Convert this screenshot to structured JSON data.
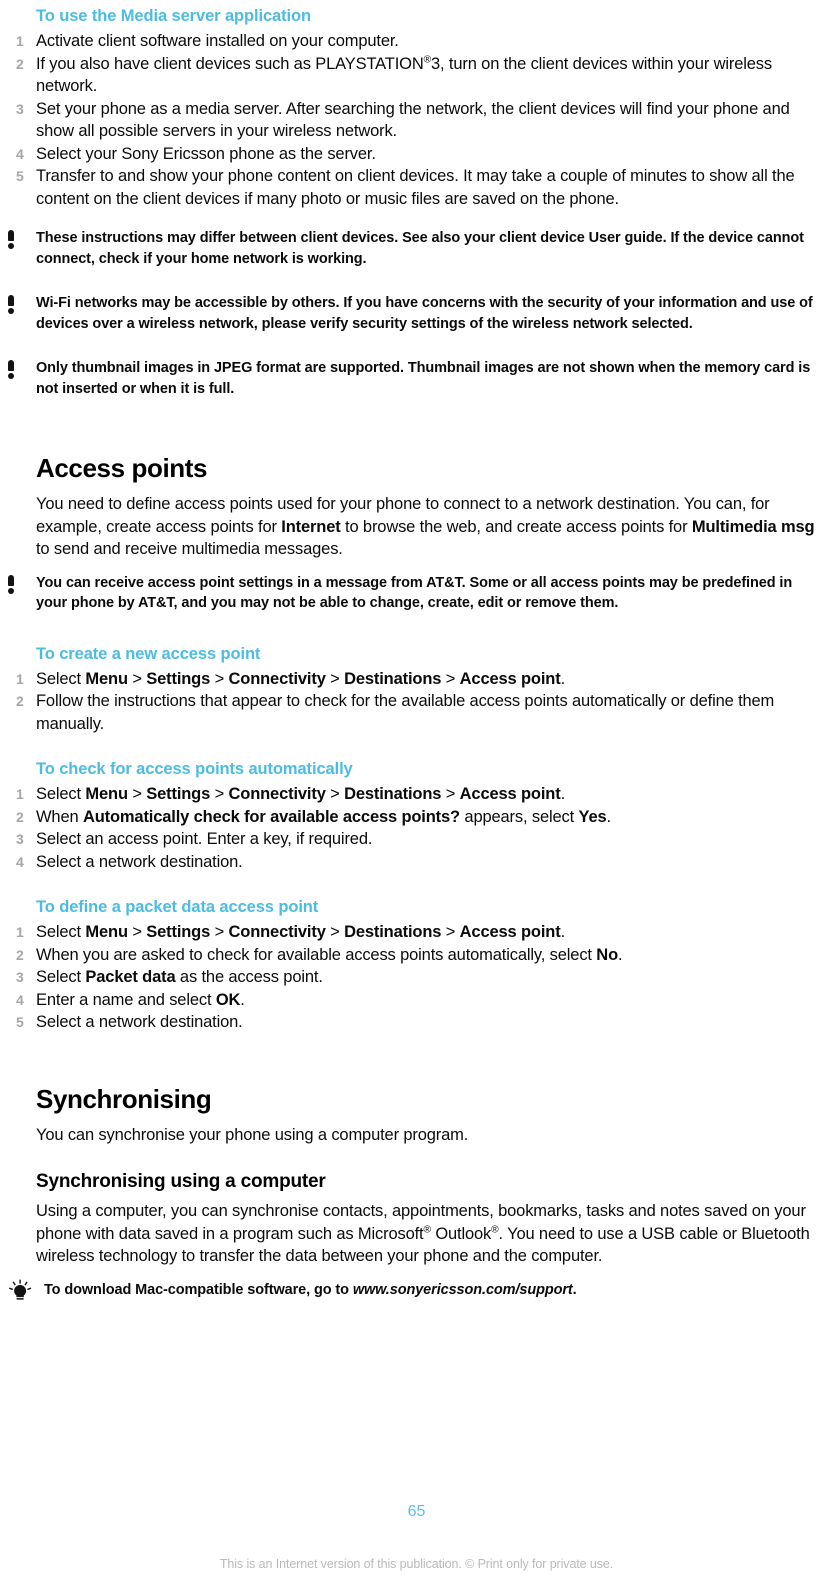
{
  "page": {
    "number": "65",
    "footer_note": "This is an Internet version of this publication. © Print only for private use.",
    "accent_color": "#4cbce2",
    "page_number_color": "#5bc2e7",
    "step_number_color": "#a6a6a6",
    "footer_color": "#b9b9b9",
    "text_color": "#0b0b0b"
  },
  "media_server": {
    "heading": "To use the Media server application",
    "steps": [
      {
        "num": "1",
        "text": "Activate client software installed on your computer."
      },
      {
        "num": "2",
        "text_before": "If you also have client devices such as PLAYSTATION",
        "sup": "®",
        "text_after": "3, turn on the client devices within your wireless network."
      },
      {
        "num": "3",
        "text": "Set your phone as a media server. After searching the network, the client devices will find your phone and show all possible servers in your wireless network."
      },
      {
        "num": "4",
        "text": "Select your Sony Ericsson phone as the server."
      },
      {
        "num": "5",
        "text": "Transfer to and show your phone content on client devices. It may take a couple of minutes to show all the content on the client devices if many photo or music files are saved on the phone."
      }
    ],
    "notes": [
      "These instructions may differ between client devices. See also your client device User guide. If the device cannot connect, check if your home network is working.",
      "Wi-Fi networks may be accessible by others. If you have concerns with the security of your information and use of devices over a wireless network, please verify security settings of the wireless network selected.",
      "Only thumbnail images in JPEG format are supported. Thumbnail images are not shown when the memory card is not inserted or when it is full."
    ]
  },
  "access_points": {
    "heading": "Access points",
    "intro_1": "You need to define access points used for your phone to connect to a network destination. You can, for example, create access points for ",
    "intro_bold_1": "Internet",
    "intro_2": " to browse the web, and create access points for ",
    "intro_bold_2": "Multimedia msg",
    "intro_3": " to send and receive multimedia messages.",
    "note": "You can receive access point settings in a message from AT&T. Some or all access points may be predefined in your phone by AT&T, and you may not be able to change, create, edit or remove them.",
    "create": {
      "heading": "To create a new access point",
      "steps": [
        {
          "num": "1",
          "prefix": "Select ",
          "path": [
            "Menu",
            "Settings",
            "Connectivity",
            "Destinations",
            "Access point"
          ],
          "separator": " > ",
          "suffix": "."
        },
        {
          "num": "2",
          "text": "Follow the instructions that appear to check for the available access points automatically or define them manually."
        }
      ]
    },
    "check_auto": {
      "heading": "To check for access points automatically",
      "steps": [
        {
          "num": "1",
          "prefix": "Select ",
          "path": [
            "Menu",
            "Settings",
            "Connectivity",
            "Destinations",
            "Access point"
          ],
          "separator": " > ",
          "suffix": "."
        },
        {
          "num": "2",
          "p1": "When ",
          "b1": "Automatically check for available access points?",
          "p2": " appears, select ",
          "b2": "Yes",
          "p3": "."
        },
        {
          "num": "3",
          "text": "Select an access point. Enter a key, if required."
        },
        {
          "num": "4",
          "text": "Select a network destination."
        }
      ]
    },
    "packet_data": {
      "heading": "To define a packet data access point",
      "steps": [
        {
          "num": "1",
          "prefix": "Select ",
          "path": [
            "Menu",
            "Settings",
            "Connectivity",
            "Destinations",
            "Access point"
          ],
          "separator": " > ",
          "suffix": "."
        },
        {
          "num": "2",
          "p1": "When you are asked to check for available access points automatically, select ",
          "b1": "No",
          "p2": "."
        },
        {
          "num": "3",
          "p1": "Select ",
          "b1": "Packet data",
          "p2": " as the access point."
        },
        {
          "num": "4",
          "p1": "Enter a name and select ",
          "b1": "OK",
          "p2": "."
        },
        {
          "num": "5",
          "text": "Select a network destination."
        }
      ]
    }
  },
  "synchronising": {
    "heading": "Synchronising",
    "intro": "You can synchronise your phone using a computer program.",
    "sub": {
      "heading": "Synchronising using a computer",
      "p1": "Using a computer, you can synchronise contacts, appointments, bookmarks, tasks and notes saved on your phone with data saved in a program such as Microsoft",
      "sup1": "®",
      "p2": " Outlook",
      "sup2": "®",
      "p3": ". You need to use a USB cable or Bluetooth wireless technology to transfer the data between your phone and the computer."
    },
    "tip": {
      "text_before": "To download Mac-compatible software, go to ",
      "link": "www.sonyericsson.com/support",
      "text_after": "."
    }
  }
}
